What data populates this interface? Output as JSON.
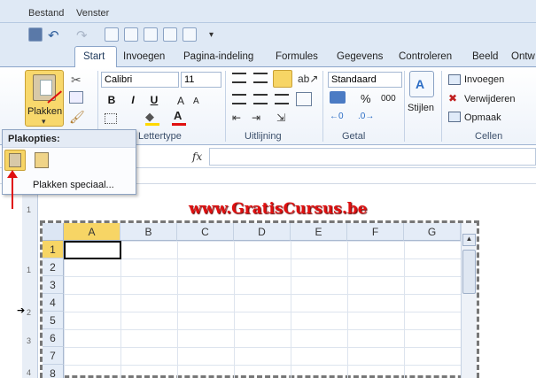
{
  "menu": {
    "file": "Bestand",
    "window": "Venster"
  },
  "tabs": [
    "Start",
    "Invoegen",
    "Pagina-indeling",
    "Formules",
    "Gegevens",
    "Controleren",
    "Beeld",
    "Ontw"
  ],
  "clipboard": {
    "paste_label": "Plakken"
  },
  "font": {
    "name": "Calibri",
    "size": "11",
    "group_label": "Lettertype"
  },
  "alignment": {
    "group_label": "Uitlijning"
  },
  "number": {
    "format": "Standaard",
    "percent": "%",
    "thousands": "000",
    "group_label": "Getal"
  },
  "styles": {
    "label": "Stijlen"
  },
  "cells": {
    "insert": "Invoegen",
    "delete": "Verwijderen",
    "format": "Opmaak",
    "group_label": "Cellen"
  },
  "formula": {
    "fx": "fx"
  },
  "sheet": {
    "columns": [
      "A",
      "B",
      "C",
      "D",
      "E",
      "F",
      "G"
    ],
    "rows": [
      "1",
      "2",
      "3",
      "4",
      "5",
      "6",
      "7",
      "8"
    ]
  },
  "popup": {
    "title": "Plakopties:",
    "paste_special": "Plakken speciaal..."
  },
  "watermark": "www.GratisCursus.be",
  "vruler_labels": [
    "1",
    "1",
    "2",
    "3",
    "4"
  ],
  "colors": {
    "accent_red": "#e01010",
    "highlight": "#f7d565"
  }
}
